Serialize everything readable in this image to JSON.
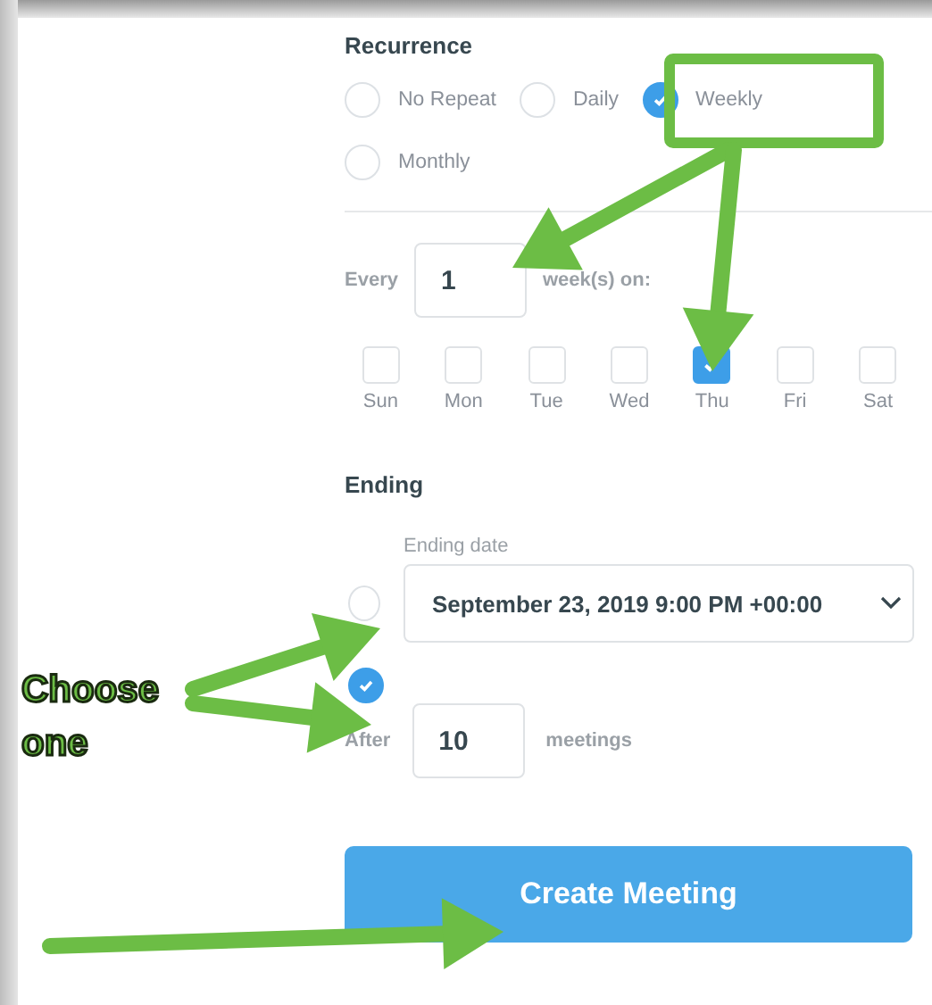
{
  "recurrence": {
    "title": "Recurrence",
    "options": [
      {
        "label": "No Repeat",
        "selected": false
      },
      {
        "label": "Daily",
        "selected": false
      },
      {
        "label": "Weekly",
        "selected": true
      },
      {
        "label": "Monthly",
        "selected": false
      }
    ]
  },
  "interval": {
    "prefix": "Every",
    "value": "1",
    "suffix": "week(s) on:"
  },
  "days": [
    {
      "label": "Sun",
      "checked": false
    },
    {
      "label": "Mon",
      "checked": false
    },
    {
      "label": "Tue",
      "checked": false
    },
    {
      "label": "Wed",
      "checked": false
    },
    {
      "label": "Thu",
      "checked": true
    },
    {
      "label": "Fri",
      "checked": false
    },
    {
      "label": "Sat",
      "checked": false
    }
  ],
  "ending": {
    "title": "Ending",
    "options": [
      {
        "kind": "date",
        "selected": false,
        "label": "Ending date",
        "value": "September 23, 2019 9:00 PM +00:00"
      },
      {
        "kind": "count",
        "selected": true,
        "prefix": "After",
        "value": "10",
        "suffix": "meetings"
      }
    ]
  },
  "button": "Create Meeting",
  "callout": "Choose one"
}
